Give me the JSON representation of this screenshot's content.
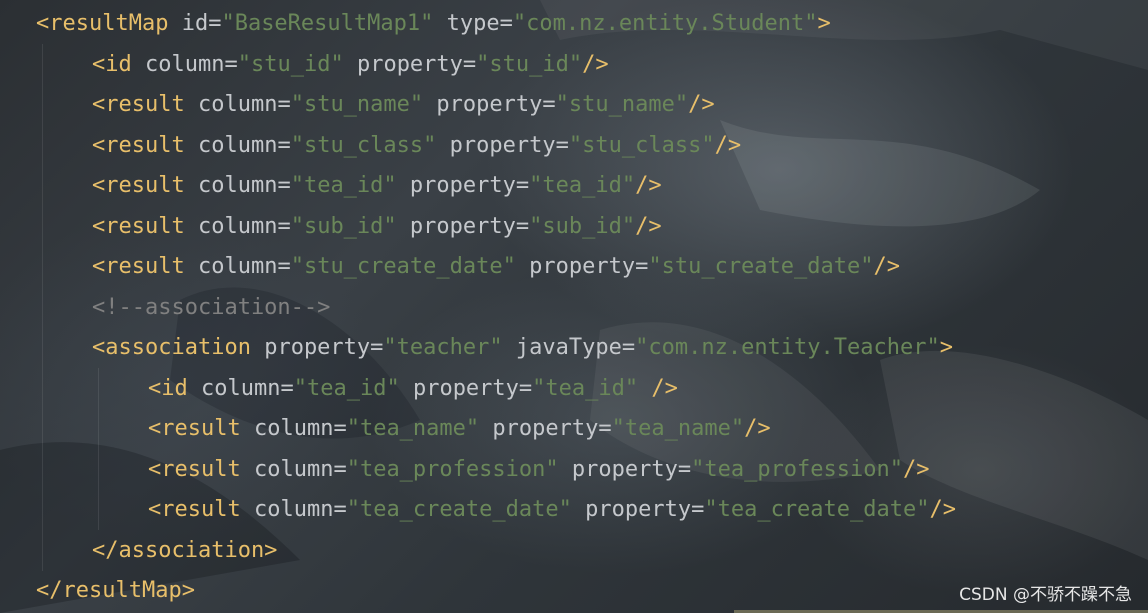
{
  "colors": {
    "tag": "#e8bf6a",
    "attribute": "#c5c8cc",
    "string_value": "#6a8759",
    "comment": "#808080",
    "watermark": "#e6e6e6"
  },
  "code": {
    "lines": [
      {
        "tag_open": "<resultMap",
        "a1": "id",
        "v1": "\"BaseResultMap1\"",
        "a2": "type",
        "v2": "\"com.nz.entity.Student\"",
        "end": ">"
      },
      {
        "tag_open": "<id",
        "a1": "column",
        "v1": "\"stu_id\"",
        "a2": "property",
        "v2": "\"stu_id\"",
        "end": "/>"
      },
      {
        "tag_open": "<result",
        "a1": "column",
        "v1": "\"stu_name\"",
        "a2": "property",
        "v2": "\"stu_name\"",
        "end": "/>"
      },
      {
        "tag_open": "<result",
        "a1": "column",
        "v1": "\"stu_class\"",
        "a2": "property",
        "v2": "\"stu_class\"",
        "end": "/>"
      },
      {
        "tag_open": "<result",
        "a1": "column",
        "v1": "\"tea_id\"",
        "a2": "property",
        "v2": "\"tea_id\"",
        "end": "/>"
      },
      {
        "tag_open": "<result",
        "a1": "column",
        "v1": "\"sub_id\"",
        "a2": "property",
        "v2": "\"sub_id\"",
        "end": "/>"
      },
      {
        "tag_open": "<result",
        "a1": "column",
        "v1": "\"stu_create_date\"",
        "a2": "property",
        "v2": "\"stu_create_date\"",
        "end": "/>"
      },
      {
        "comment": "<!--association-->"
      },
      {
        "tag_open": "<association",
        "a1": "property",
        "v1": "\"teacher\"",
        "a2": "javaType",
        "v2": "\"com.nz.entity.Teacher\"",
        "end": ">"
      },
      {
        "tag_open": "<id",
        "a1": "column",
        "v1": "\"tea_id\"",
        "a2": "property",
        "v2": "\"tea_id\"",
        "end": " />"
      },
      {
        "tag_open": "<result",
        "a1": "column",
        "v1": "\"tea_name\"",
        "a2": "property",
        "v2": "\"tea_name\"",
        "end": "/>"
      },
      {
        "tag_open": "<result",
        "a1": "column",
        "v1": "\"tea_profession\"",
        "a2": "property",
        "v2": "\"tea_profession\"",
        "end": "/>"
      },
      {
        "tag_open": "<result",
        "a1": "column",
        "v1": "\"tea_create_date\"",
        "a2": "property",
        "v2": "\"tea_create_date\"",
        "end": "/>"
      },
      {
        "tag_close": "</association>"
      },
      {
        "tag_close": "</resultMap>"
      }
    ]
  },
  "watermark": {
    "text": "CSDN @不骄不躁不急"
  }
}
